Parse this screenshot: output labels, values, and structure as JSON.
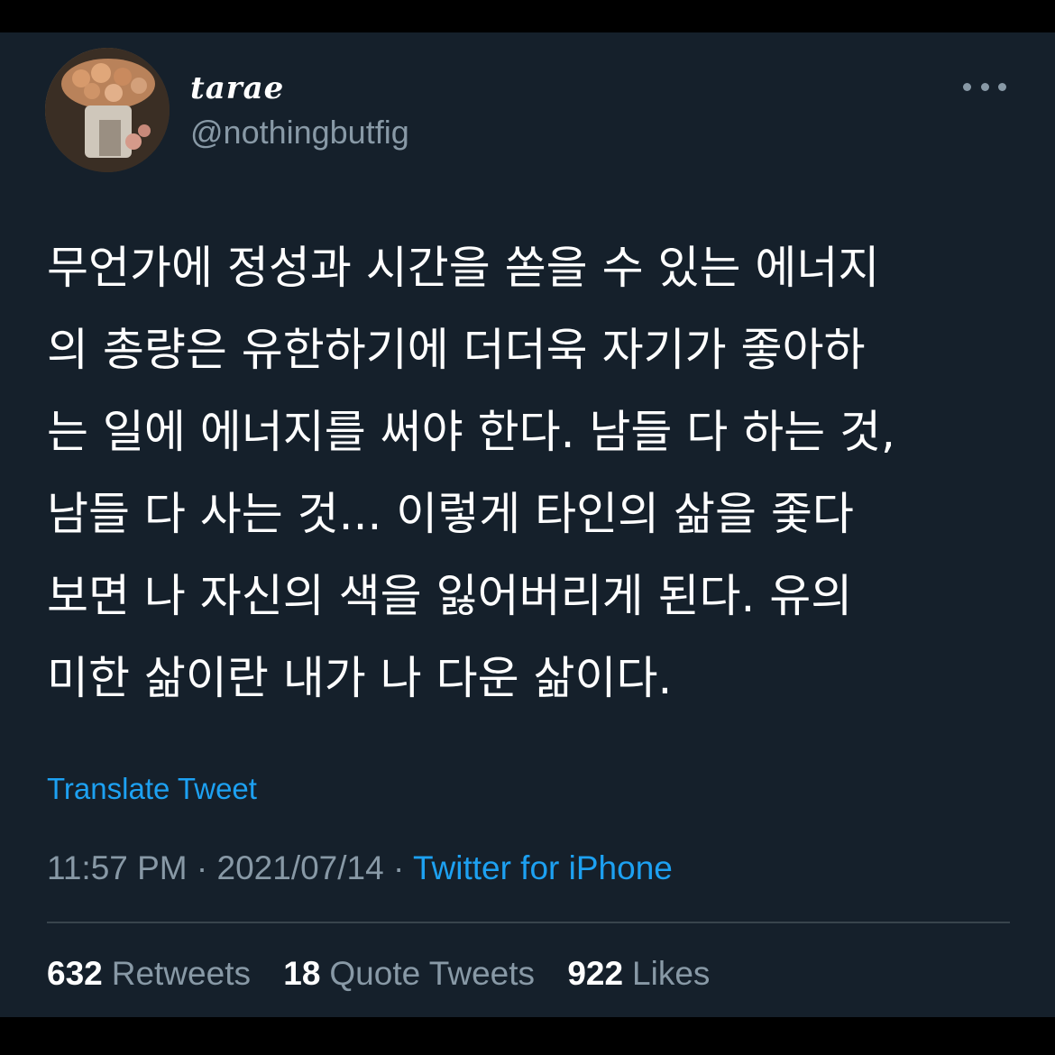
{
  "author": {
    "display_name": "tarae",
    "handle": "@nothingbutfig",
    "avatar_description": "bouquet-photo"
  },
  "menu": {
    "icon": "more-horizontal-icon"
  },
  "tweet": {
    "lines": [
      "무언가에 정성과 시간을 쏟을 수 있는 에너지",
      "의 총량은 유한하기에 더더욱 자기가 좋아하",
      "는 일에 에너지를 써야 한다. 남들 다 하는 것,",
      "남들 다 사는 것... 이렇게 타인의 삶을 좇다",
      "보면 나 자신의 색을 잃어버리게 된다. 유의",
      "미한 삶이란 내가 나 다운 삶이다."
    ]
  },
  "translate_label": "Translate Tweet",
  "meta": {
    "time": "11:57 PM",
    "separator": "·",
    "date": "2021/07/14",
    "source": "Twitter for iPhone"
  },
  "stats": {
    "retweets": {
      "count": "632",
      "label": "Retweets"
    },
    "quote_tweets": {
      "count": "18",
      "label": "Quote Tweets"
    },
    "likes": {
      "count": "922",
      "label": "Likes"
    }
  },
  "colors": {
    "background": "#15202b",
    "accent": "#1da1f2",
    "secondary_text": "#8899a6",
    "divider": "#38444d"
  }
}
